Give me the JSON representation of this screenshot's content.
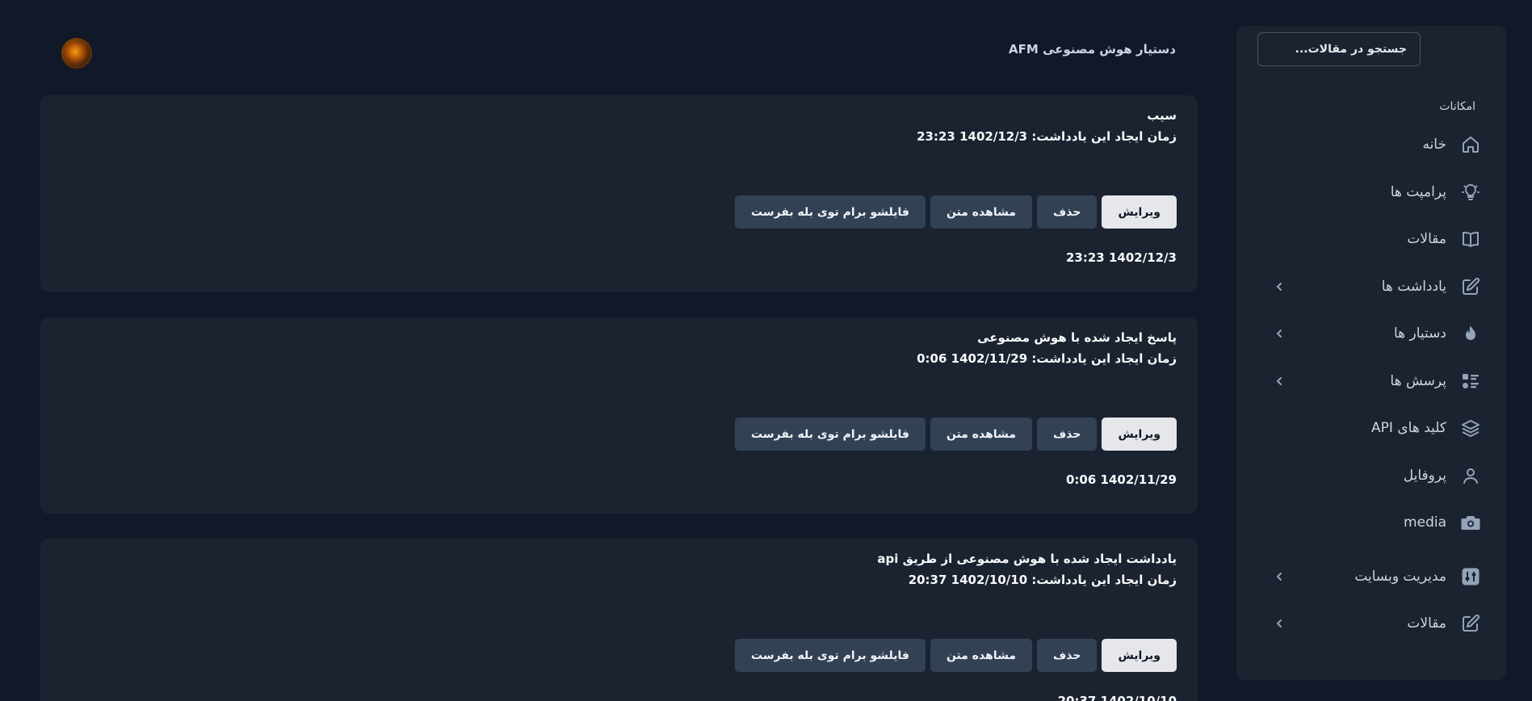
{
  "header": {
    "app_title": "دستیار هوش مصنوعی AFM"
  },
  "sidebar": {
    "search_placeholder": "جستجو در مقالات...",
    "section_title": "امکانات",
    "items": [
      {
        "label": "خانه",
        "icon": "home-icon"
      },
      {
        "label": "پرامپت ها",
        "icon": "lightbulb-icon"
      },
      {
        "label": "مقالات",
        "icon": "book-icon"
      },
      {
        "label": "یادداشت ها",
        "icon": "edit-icon",
        "has_submenu": true
      },
      {
        "label": "دستیار ها",
        "icon": "flame-icon",
        "has_submenu": true
      },
      {
        "label": "پرسش ها",
        "icon": "list-icon",
        "has_submenu": true
      },
      {
        "label": "کلید های API",
        "icon": "layers-icon"
      },
      {
        "label": "پروفایل",
        "icon": "user-icon"
      },
      {
        "label": "media",
        "icon": "camera-icon"
      },
      {
        "label": "مدیریت وبسایت",
        "icon": "sliders-icon",
        "has_submenu": true
      },
      {
        "label": "مقالات",
        "icon": "edit-icon",
        "has_submenu": true
      }
    ]
  },
  "buttons": {
    "edit": "ویرایش",
    "delete": "حذف",
    "view_text": "مشاهده متن",
    "send_file": "فایلشو برام توی بله بفرست"
  },
  "notes": [
    {
      "title": "سیب",
      "meta": "زمان ایجاد این یادداشت: 1402/12/3 23:23",
      "date": "23:23 1402/12/3"
    },
    {
      "title": "پاسخ ایجاد شده با هوش مصنوعی",
      "meta": "زمان ایجاد این یادداشت: 1402/11/29 0:06",
      "date": "0:06 1402/11/29"
    },
    {
      "title": "یادداشت ایجاد شده با هوش مصنوعی از طریق api",
      "meta": "زمان ایجاد این یادداشت: 1402/10/10 20:37",
      "date": "20:37 1402/10/10"
    }
  ]
}
